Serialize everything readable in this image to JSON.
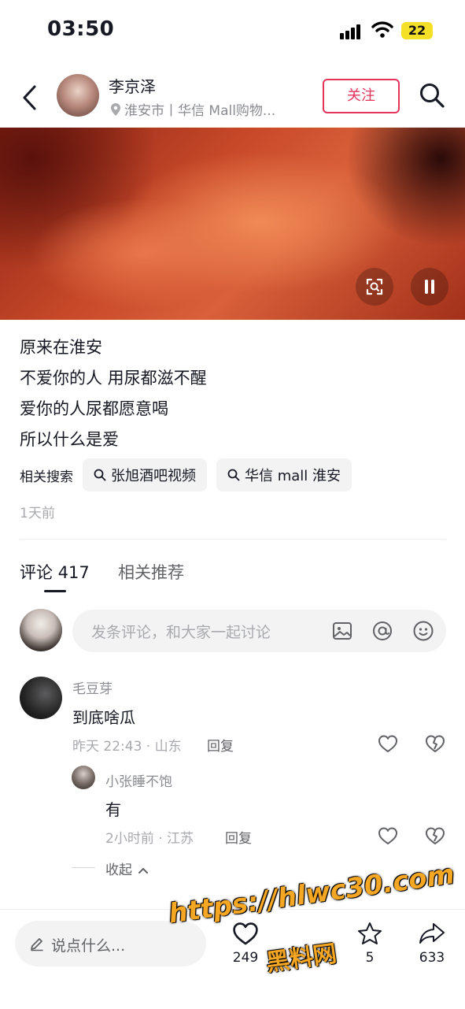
{
  "status_bar": {
    "time": "03:50",
    "battery": "22"
  },
  "header": {
    "author_name": "李京泽",
    "location": "淮安市丨华信 Mall购物...",
    "follow_label": "关注"
  },
  "post": {
    "caption_lines": [
      "原来在淮安",
      "不爱你的人 用尿都滋不醒",
      "爱你的人尿都愿意喝",
      "所以什么是爱"
    ],
    "related_label": "相关搜索",
    "related_chips": [
      "张旭酒吧视频",
      "华信 mall 淮安"
    ],
    "posted_time": "1天前"
  },
  "tabs": {
    "comments_label": "评论 417",
    "recommend_label": "相关推荐"
  },
  "comment_input": {
    "placeholder": "发条评论，和大家一起讨论"
  },
  "comments": [
    {
      "name": "毛豆芽",
      "text": "到底啥瓜",
      "meta": "昨天 22:43 · 山东",
      "reply_label": "回复",
      "replies": [
        {
          "name": "小张睡不饱",
          "text": "有",
          "meta": "2小时前 · 江苏",
          "reply_label": "回复"
        }
      ],
      "collapse_label": "收起"
    }
  ],
  "bottom_bar": {
    "say_placeholder": "说点什么...",
    "like_count": "249",
    "fav_count": "5",
    "share_count": "633"
  },
  "watermark": {
    "line1": "https://hlwc30.com",
    "line2": "黑料网"
  },
  "colors": {
    "accent": "#e5345a",
    "text": "#161823",
    "muted": "#a9aaae"
  }
}
